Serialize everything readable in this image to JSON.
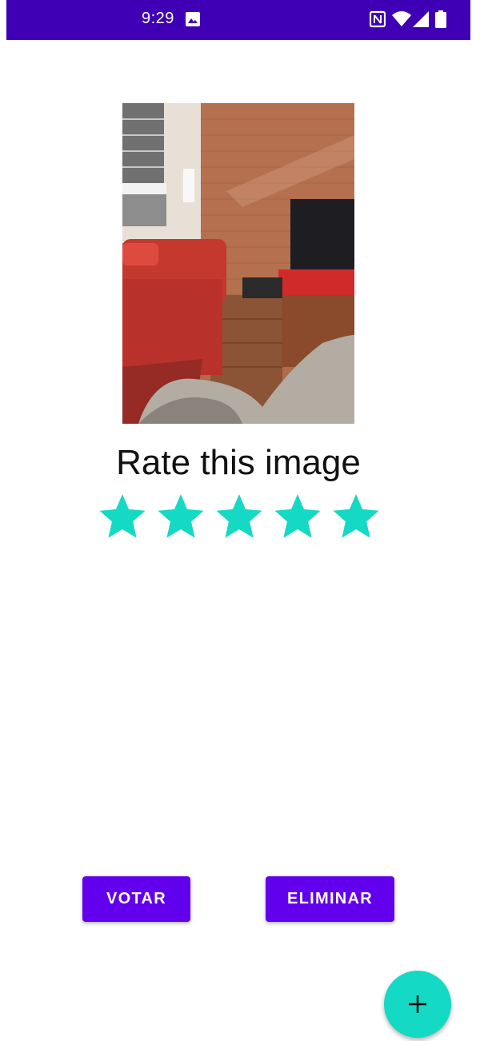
{
  "status_bar": {
    "time": "9:29",
    "icons": [
      "gallery-icon",
      "nfc-icon",
      "wifi-icon",
      "signal-icon",
      "battery-icon"
    ],
    "background_color": "#3f00b5"
  },
  "main": {
    "image_description_icon": "photo-living-room",
    "rate_title": "Rate this image",
    "rating": {
      "max_stars": 5,
      "value": 5,
      "star_color": "#14d9c4"
    }
  },
  "actions": {
    "vote_label": "VOTAR",
    "delete_label": "ELIMINAR",
    "button_color": "#6200ee"
  },
  "fab": {
    "icon": "plus-icon",
    "color": "#14d9c4"
  }
}
